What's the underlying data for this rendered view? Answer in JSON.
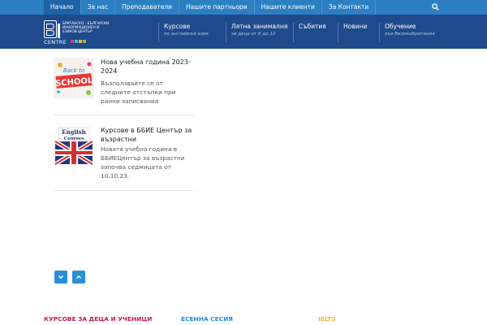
{
  "topnav": {
    "items": [
      {
        "label": "Начало"
      },
      {
        "label": "За нас"
      },
      {
        "label": "Преподаватели"
      },
      {
        "label": "Нашите партньори"
      },
      {
        "label": "Нашите клиенти"
      },
      {
        "label": "За Контакти"
      }
    ],
    "active_index": 0,
    "search_icon": "search-icon"
  },
  "logo": {
    "text_line1": "БРИТАНСКО - БЪЛГАРСКИ",
    "text_line2": "ИНФОРМАЦИОНЕН И",
    "text_line3": "ЕЗИКОВ ЦЕНТЪР",
    "centre": "CENTRE"
  },
  "mainnav": [
    {
      "label": "Курсове",
      "sub": "по английски език"
    },
    {
      "label": "Лятна занималня",
      "sub": "за деца от 6 до 12"
    },
    {
      "label": "Събития",
      "sub": ""
    },
    {
      "label": "Новини",
      "sub": ""
    },
    {
      "label": "Обучение",
      "sub": "във Великобритания"
    }
  ],
  "posts": [
    {
      "title": "Нова учебна година 2023-2024",
      "excerpt": "Възползвайте се от следните отстъпки при ранни записвания",
      "thumb_text": "Back to SCHOOL"
    },
    {
      "title": "Курсове в ББИЕ Център за възрастни",
      "excerpt": "Новата учебна година в ББИЕЦентър за възрастни започва седмицата от 10.10.23.",
      "thumb_text": "English Courses"
    }
  ],
  "pager": {
    "down_icon": "chevron-down-icon",
    "up_icon": "chevron-up-icon"
  },
  "footer": [
    {
      "label": "КУРСОВЕ ЗА ДЕЦА И УЧЕНИЦИ",
      "color": "#c2185b"
    },
    {
      "label": "ЕСЕННА СЕСИЯ",
      "color": "#1e88e5"
    },
    {
      "label": "IELTS",
      "color": "#f2b233"
    }
  ],
  "colors": {
    "topbar": "#2b7fc2",
    "header": "#1f4a8c",
    "accent": "#2b8fd8"
  }
}
